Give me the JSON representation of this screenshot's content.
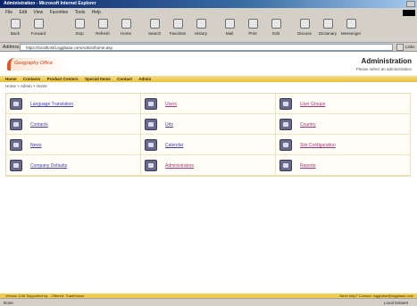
{
  "window": {
    "title": "Administration - Microsoft Internet Explorer"
  },
  "menu": [
    "File",
    "Edit",
    "View",
    "Favorites",
    "Tools",
    "Help"
  ],
  "toolbar": [
    "Back",
    "Forward",
    "Stop",
    "Refresh",
    "Home",
    "Search",
    "Favorites",
    "History",
    "Mail",
    "Print",
    "Edit",
    "Discuss",
    "Dictionary",
    "Messenger"
  ],
  "address": {
    "label": "Address",
    "value": "https://localhost/Loggbase.com/Admin/home.asp",
    "links_label": "Links"
  },
  "header": {
    "logo_text": "Geography Office",
    "title": "Administration",
    "subtitle": "Please select an administration"
  },
  "nav": [
    "Home",
    "Contacts",
    "Product Centers",
    "Special Items",
    "Contact",
    "Admin"
  ],
  "breadcrumb": "Home  >  Admin  >  Home",
  "items": [
    {
      "label": "Language Translation",
      "color": "blue"
    },
    {
      "label": "Users",
      "color": "mag"
    },
    {
      "label": "User Groups",
      "color": "mag"
    },
    {
      "label": "Contacts",
      "color": "blue"
    },
    {
      "label": "Urls",
      "color": "blue"
    },
    {
      "label": "Country",
      "color": "mag"
    },
    {
      "label": "News",
      "color": "blue"
    },
    {
      "label": "Calendar",
      "color": "blue"
    },
    {
      "label": "Site Configuration",
      "color": "mag"
    },
    {
      "label": "Company Defaults",
      "color": "blue"
    },
    {
      "label": "Administrators",
      "color": "mag"
    },
    {
      "label": "Reports",
      "color": "mag"
    }
  ],
  "footer": {
    "left": "Version 3.06  Supported by: - Offered: Tradehouse",
    "right": "Need help? Contact: loggbase@loggbase.com"
  },
  "status": {
    "done": "Done",
    "zone": "Local intranet"
  },
  "colors": {
    "nav_gold": "#e9bf3a",
    "link_blue": "#3b3bc4",
    "link_magenta": "#b0307a",
    "titlebar": "#0a246a"
  }
}
